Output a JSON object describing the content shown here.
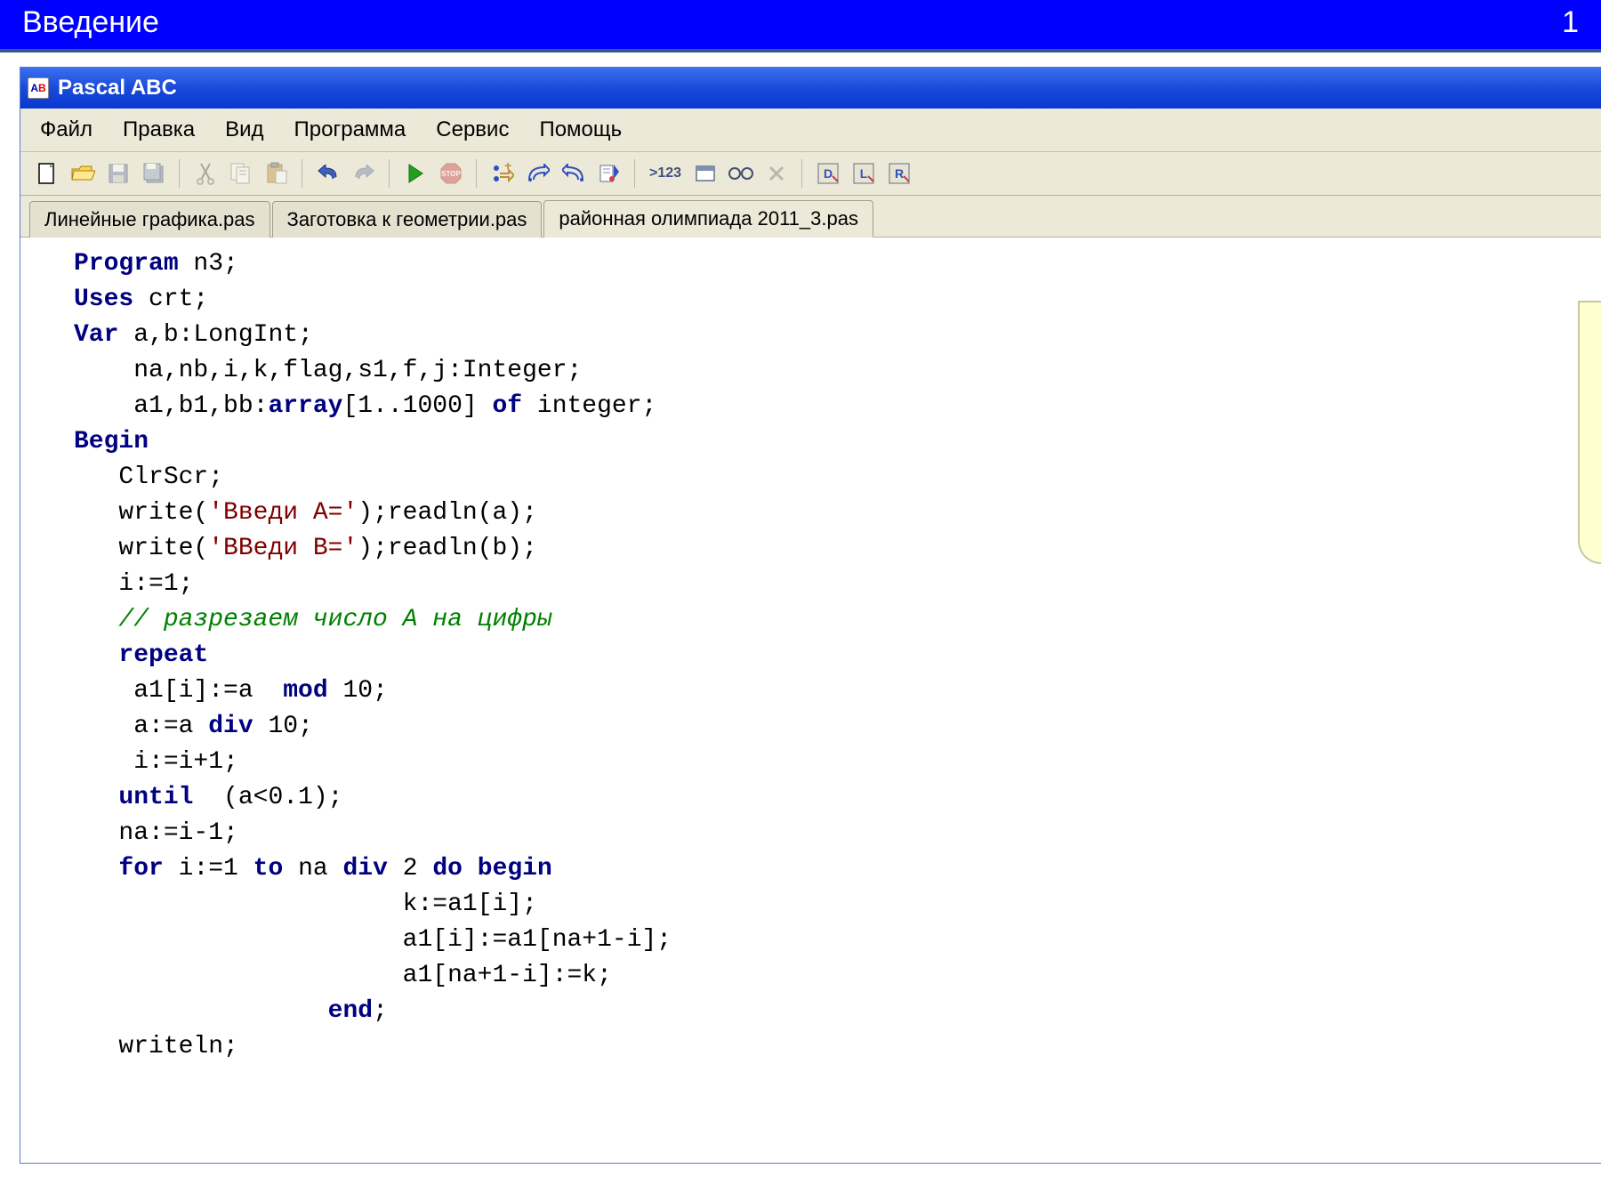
{
  "slide": {
    "title": "Введение",
    "page": "1"
  },
  "window": {
    "title": "Pascal ABC"
  },
  "menu": {
    "items": [
      "Файл",
      "Правка",
      "Вид",
      "Программа",
      "Сервис",
      "Помощь"
    ]
  },
  "toolbar": {
    "new": "new",
    "open": "open",
    "save": "save",
    "saveall": "saveall",
    "cut": "cut",
    "copy": "copy",
    "paste": "paste",
    "undo": "undo",
    "redo": "redo",
    "run": "run",
    "stop": "stop",
    "stepinto": "stepinto",
    "stepover": "stepover",
    "stepout": "stepout",
    "cursor": "cursor",
    "bp": ">123",
    "win": "win",
    "view": "view",
    "close": "close",
    "d": "D",
    "l": "L",
    "r": "R"
  },
  "tabs": {
    "items": [
      {
        "label": "Линейные графика.pas",
        "active": false
      },
      {
        "label": "Заготовка к геометрии.pas",
        "active": false
      },
      {
        "label": "районная олимпиада 2011_3.pas",
        "active": true
      }
    ]
  },
  "code": {
    "l1_kw": "Program",
    "l1_rest": " n3;",
    "l2_kw": "Uses",
    "l2_rest": " crt;",
    "l3_kw": "Var",
    "l3_rest": " a,b:LongInt;",
    "l4": "    na,nb,i,k,flag,s1,f,j:Integer;",
    "l5a": "    a1,b1,bb:",
    "l5_kw": "array",
    "l5b": "[1..1000] ",
    "l5_kw2": "of",
    "l5c": " integer;",
    "l6_kw": "Begin",
    "l7": "   ClrScr;",
    "l8a": "   write(",
    "l8_str": "'Введи A='",
    "l8b": ");readln(a);",
    "l9a": "   write(",
    "l9_str": "'ВВеди В='",
    "l9b": ");readln(b);",
    "l10": "   i:=1;",
    "l11_cmt": "   // разрезаем число А на цифры",
    "l12_kw": "repeat",
    "l13a": "    a1[i]:=a  ",
    "l13_kw": "mod",
    "l13b": " 10;",
    "l14a": "    a:=a ",
    "l14_kw": "div",
    "l14b": " 10;",
    "l15": "    i:=i+1;",
    "l16_kw": "until",
    "l16b": "  (a<0.1);",
    "l17": "   na:=i-1;",
    "l18_kw1": "for",
    "l18a": " i:=1 ",
    "l18_kw2": "to",
    "l18b": " na ",
    "l18_kw3": "div",
    "l18c": " 2 ",
    "l18_kw4": "do",
    "l18_kw5": "begin",
    "l19": "                      k:=a1[i];",
    "l20": "                      a1[i]:=a1[na+1-i];",
    "l21": "                      a1[na+1-i]:=k;",
    "l22_kw": "end",
    "l22b": ";",
    "l23": "   writeln;"
  }
}
